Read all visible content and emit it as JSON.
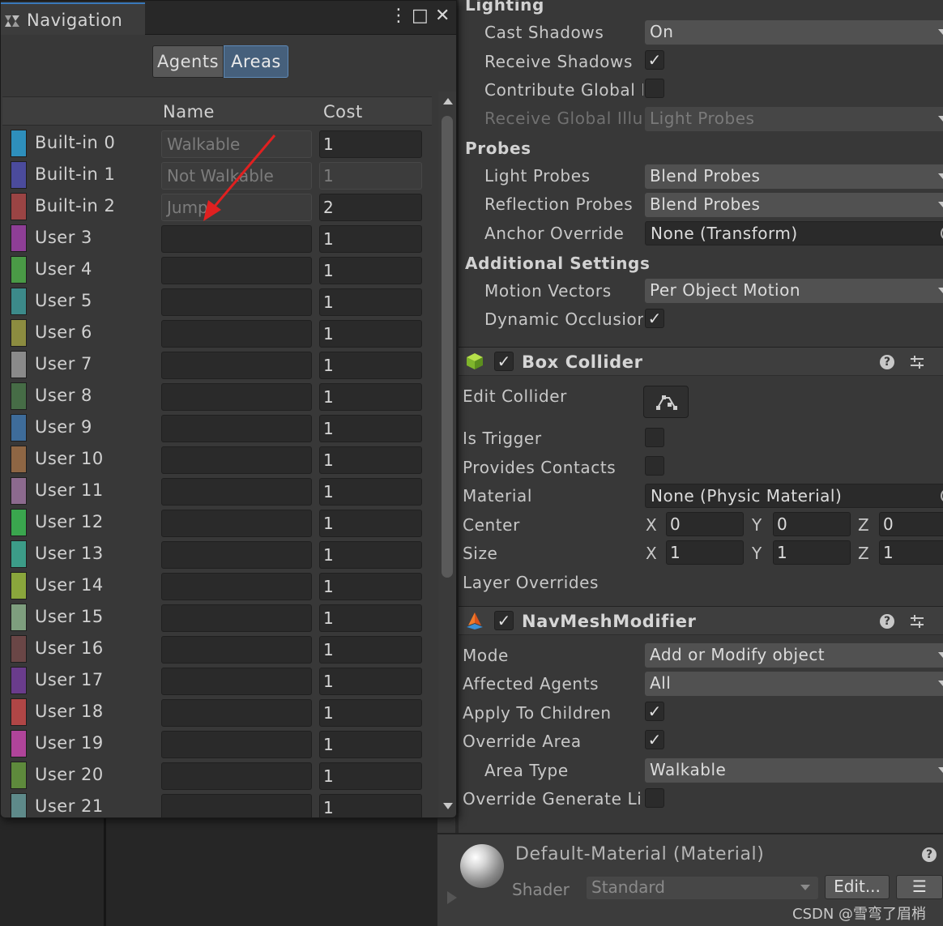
{
  "navigation": {
    "tab_title": "Navigation",
    "window_icon": "navmesh-icon",
    "controls": {
      "more": "⋮",
      "maximize": "□",
      "close": "✕"
    },
    "segments": {
      "agents": "Agents",
      "areas": "Areas"
    },
    "columns": {
      "name": "Name",
      "cost": "Cost"
    },
    "areas": [
      {
        "label": "Built-in 0",
        "name": "Walkable",
        "cost": "1",
        "color": "#2e8fbc",
        "readonly_name": true,
        "readonly_cost": false
      },
      {
        "label": "Built-in 1",
        "name": "Not Walkable",
        "cost": "1",
        "color": "#4b4b9c",
        "readonly_name": true,
        "readonly_cost": true
      },
      {
        "label": "Built-in 2",
        "name": "Jump",
        "cost": "2",
        "color": "#9a4444",
        "readonly_name": true,
        "readonly_cost": false
      },
      {
        "label": "User 3",
        "name": "",
        "cost": "1",
        "color": "#8e3e96",
        "readonly_name": false,
        "readonly_cost": false
      },
      {
        "label": "User 4",
        "name": "",
        "cost": "1",
        "color": "#4a9a46",
        "readonly_name": false,
        "readonly_cost": false
      },
      {
        "label": "User 5",
        "name": "",
        "cost": "1",
        "color": "#3c8a8a",
        "readonly_name": false,
        "readonly_cost": false
      },
      {
        "label": "User 6",
        "name": "",
        "cost": "1",
        "color": "#8c8c40",
        "readonly_name": false,
        "readonly_cost": false
      },
      {
        "label": "User 7",
        "name": "",
        "cost": "1",
        "color": "#8a8a8a",
        "readonly_name": false,
        "readonly_cost": false
      },
      {
        "label": "User 8",
        "name": "",
        "cost": "1",
        "color": "#466c46",
        "readonly_name": false,
        "readonly_cost": false
      },
      {
        "label": "User 9",
        "name": "",
        "cost": "1",
        "color": "#3e6c9a",
        "readonly_name": false,
        "readonly_cost": false
      },
      {
        "label": "User 10",
        "name": "",
        "cost": "1",
        "color": "#8e6644",
        "readonly_name": false,
        "readonly_cost": false
      },
      {
        "label": "User 11",
        "name": "",
        "cost": "1",
        "color": "#8c6a8e",
        "readonly_name": false,
        "readonly_cost": false
      },
      {
        "label": "User 12",
        "name": "",
        "cost": "1",
        "color": "#3aa64e",
        "readonly_name": false,
        "readonly_cost": false
      },
      {
        "label": "User 13",
        "name": "",
        "cost": "1",
        "color": "#3c9c88",
        "readonly_name": false,
        "readonly_cost": false
      },
      {
        "label": "User 14",
        "name": "",
        "cost": "1",
        "color": "#8aa63c",
        "readonly_name": false,
        "readonly_cost": false
      },
      {
        "label": "User 15",
        "name": "",
        "cost": "1",
        "color": "#7e9e7e",
        "readonly_name": false,
        "readonly_cost": false
      },
      {
        "label": "User 16",
        "name": "",
        "cost": "1",
        "color": "#6a4646",
        "readonly_name": false,
        "readonly_cost": false
      },
      {
        "label": "User 17",
        "name": "",
        "cost": "1",
        "color": "#6a3c8c",
        "readonly_name": false,
        "readonly_cost": false
      },
      {
        "label": "User 18",
        "name": "",
        "cost": "1",
        "color": "#b04646",
        "readonly_name": false,
        "readonly_cost": false
      },
      {
        "label": "User 19",
        "name": "",
        "cost": "1",
        "color": "#b0449a",
        "readonly_name": false,
        "readonly_cost": false
      },
      {
        "label": "User 20",
        "name": "",
        "cost": "1",
        "color": "#5e8a3c",
        "readonly_name": false,
        "readonly_cost": false
      },
      {
        "label": "User 21",
        "name": "",
        "cost": "1",
        "color": "#5e8a8a",
        "readonly_name": false,
        "readonly_cost": false
      }
    ]
  },
  "inspector": {
    "lighting": {
      "header": "Lighting",
      "cast_shadows": {
        "label": "Cast Shadows",
        "value": "On"
      },
      "receive_shadows": {
        "label": "Receive Shadows",
        "checked": "✓"
      },
      "contribute_gi": {
        "label": "Contribute Global I"
      },
      "receive_gi": {
        "label": "Receive Global Illu",
        "value": "Light Probes"
      }
    },
    "probes": {
      "header": "Probes",
      "light_probes": {
        "label": "Light Probes",
        "value": "Blend Probes"
      },
      "reflection_probes": {
        "label": "Reflection Probes",
        "value": "Blend Probes"
      },
      "anchor_override": {
        "label": "Anchor Override",
        "value": "None (Transform)"
      }
    },
    "additional": {
      "header": "Additional Settings",
      "motion_vectors": {
        "label": "Motion Vectors",
        "value": "Per Object Motion"
      },
      "dynamic_occlusion": {
        "label": "Dynamic Occlusior",
        "checked": "✓"
      }
    },
    "box_collider": {
      "title": "Box Collider",
      "enabled_check": "✓",
      "help": "?",
      "edit_collider": "Edit Collider",
      "is_trigger": "Is Trigger",
      "provides_contacts": "Provides Contacts",
      "material": {
        "label": "Material",
        "value": "None (Physic Material)"
      },
      "center": {
        "label": "Center",
        "x": "0",
        "y": "0",
        "z": "0"
      },
      "size": {
        "label": "Size",
        "x": "1",
        "y": "1",
        "z": "1"
      },
      "axis": {
        "x": "X",
        "y": "Y",
        "z": "Z"
      },
      "layer_overrides": "Layer Overrides"
    },
    "navmesh_modifier": {
      "title": "NavMeshModifier",
      "enabled_check": "✓",
      "help": "?",
      "mode": {
        "label": "Mode",
        "value": "Add or Modify object"
      },
      "affected_agents": {
        "label": "Affected Agents",
        "value": "All"
      },
      "apply_to_children": {
        "label": "Apply To Children",
        "checked": "✓"
      },
      "override_area": {
        "label": "Override Area",
        "checked": "✓"
      },
      "area_type": {
        "label": "Area Type",
        "value": "Walkable"
      },
      "override_generate": {
        "label": "Override Generate Lir"
      }
    },
    "material": {
      "title": "Default-Material (Material)",
      "help": "?",
      "shader_label": "Shader",
      "shader_value": "Standard",
      "edit_button": "Edit...",
      "list_button": "☰"
    }
  },
  "watermark": "CSDN @雪弯了眉梢",
  "colors": {
    "accent": "#3a79bb",
    "annotation_arrow": "#e02020"
  }
}
